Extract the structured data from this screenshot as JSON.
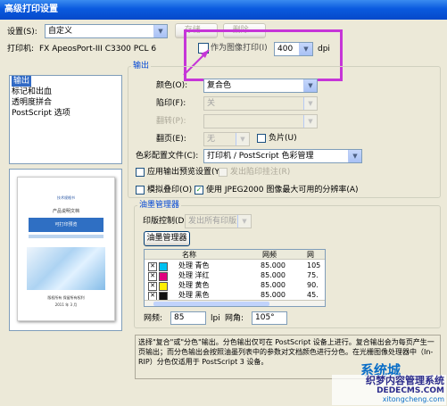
{
  "window": {
    "title": "高级打印设置"
  },
  "top": {
    "settings_label": "设置(S):",
    "settings_value": "自定义",
    "save_label": "存储...",
    "delete_label": "删除...",
    "printer_label": "打印机:",
    "printer_value": "FX ApeosPort-III C3300 PCL 6",
    "rasterize_label": "作为图像打印(I)",
    "dpi_value": "400",
    "dpi_unit": "dpi"
  },
  "tree": {
    "items": [
      "输出",
      "标记和出血",
      "透明度拼合",
      "PostScript 选项"
    ]
  },
  "preview": {
    "lines": [
      "技术规格书",
      "产品说明文档",
      "可打印预览",
      "标准打印样张"
    ],
    "bottom_lines": [
      "版权所有 保留所有权利",
      "2011 年 3 月"
    ]
  },
  "output": {
    "group_label": "输出",
    "color_label": "颜色(O):",
    "color_value": "复合色",
    "trap_label": "陷印(F):",
    "trap_value": "关",
    "flip_label": "翻转(P):",
    "flip_value": "",
    "page_label": "翻页(E):",
    "page_value": "无",
    "negative_label": "负片(U)",
    "profile_label": "色彩配置文件(C):",
    "profile_value": "打印机 / PostScript 色彩管理",
    "overprint_preview_label": "应用输出预览设置(Y)",
    "overprint_black_label": "发出陷印挂注(R)",
    "simulate_overprint_label": "模拟叠印(O)",
    "jpeg2000_label": "使用 JPEG2000 图像最大可用的分辨率(A)"
  },
  "ink": {
    "group_label": "油墨管理器",
    "document_ink_label": "印版控制(D):",
    "document_ink_value": "发出所有印版",
    "manager_button": "油墨管理器",
    "columns": [
      "名称",
      "网频",
      "网"
    ],
    "rows": [
      {
        "name": "处理 青色",
        "freq": "85.000",
        "angle": "105",
        "color": "#00c0f0"
      },
      {
        "name": "处理 洋红",
        "freq": "85.000",
        "angle": "75.",
        "color": "#e0007e"
      },
      {
        "name": "处理 黄色",
        "freq": "85.000",
        "angle": "90.",
        "color": "#ffee00"
      },
      {
        "name": "处理 黑色",
        "freq": "85.000",
        "angle": "45.",
        "color": "#111111"
      }
    ],
    "freq_label": "网频:",
    "freq_value": "85",
    "freq_unit": "lpi",
    "angle_label": "网角:",
    "angle_value": "105°"
  },
  "description": "选择\"复合\"或\"分色\"输出。分色输出仅可在 PostScript 设备上进行。复合输出会为每页产生一页输出；而分色输出会按照油墨列表中的参数对文档颜色进行分色。在光栅图像处理器中（In-RIP）分色仅适用于 PostScript 3 设备。",
  "watermark": {
    "brand": "系统城",
    "site": "织梦内容管理系统",
    "url": "DEDECMS.COM",
    "url2": "xitongcheng.com"
  },
  "colors": {
    "highlight": "#c635d8"
  }
}
